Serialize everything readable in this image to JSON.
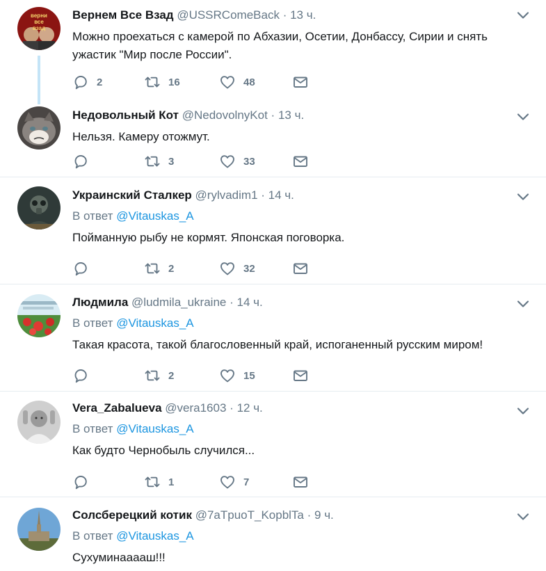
{
  "tweets": [
    {
      "name": "Вернем Все Взад",
      "handle": "@USSRComeBack",
      "dot": "·",
      "time": "13 ч.",
      "reply_prefix": "",
      "reply_mention": "",
      "text_lines": [
        "Можно проехаться с камерой по Абхазии, Осетии, Донбассу, Сирии и снять",
        "ужастик \"Мир после России\"."
      ],
      "replies": "2",
      "retweets": "16",
      "likes": "48"
    },
    {
      "name": "Недовольный Кот",
      "handle": "@NedovolnyKot",
      "dot": "·",
      "time": "13 ч.",
      "reply_prefix": "",
      "reply_mention": "",
      "text_lines": [
        "Нельзя. Камеру отожмут."
      ],
      "replies": "",
      "retweets": "3",
      "likes": "33"
    },
    {
      "name": "Украинский Сталкер",
      "handle": "@rylvadim1",
      "dot": "·",
      "time": "14 ч.",
      "reply_prefix": "В ответ",
      "reply_mention": "@Vitauskas_A",
      "text_lines": [
        "Пойманную рыбу не кормят. Японская поговорка."
      ],
      "replies": "",
      "retweets": "2",
      "likes": "32"
    },
    {
      "name": "Людмила",
      "handle": "@ludmila_ukraine",
      "dot": "·",
      "time": "14 ч.",
      "reply_prefix": "В ответ",
      "reply_mention": "@Vitauskas_A",
      "text_lines": [
        "Такая красота, такой благословенный край, испоганенный русским миром!"
      ],
      "replies": "",
      "retweets": "2",
      "likes": "15"
    },
    {
      "name": "Vera_Zabalueva",
      "handle": "@vera1603",
      "dot": "·",
      "time": "12 ч.",
      "reply_prefix": "В ответ",
      "reply_mention": "@Vitauskas_A",
      "text_lines": [
        "Как будто Чернобыль случился..."
      ],
      "replies": "",
      "retweets": "1",
      "likes": "7"
    },
    {
      "name": "Солсберецкий котик",
      "handle": "@7aTpuoT_KopblTa",
      "dot": "·",
      "time": "9 ч.",
      "reply_prefix": "В ответ",
      "reply_mention": "@Vitauskas_A",
      "text_lines": [
        "Сухуминааааш!!!"
      ],
      "replies": "",
      "retweets": "",
      "likes": ""
    }
  ],
  "avatar_text": [
    "верни",
    "все",
    "взад"
  ],
  "colors": {
    "icon_gray": "#657786",
    "link_blue": "#1b95e0",
    "thread_line": "#c4e4f7",
    "divider": "#e6ecf0"
  },
  "icons": {
    "reply": "speech-bubble",
    "retweet": "retweet-arrows",
    "like": "heart-outline",
    "dm": "envelope",
    "more": "chevron-down"
  }
}
